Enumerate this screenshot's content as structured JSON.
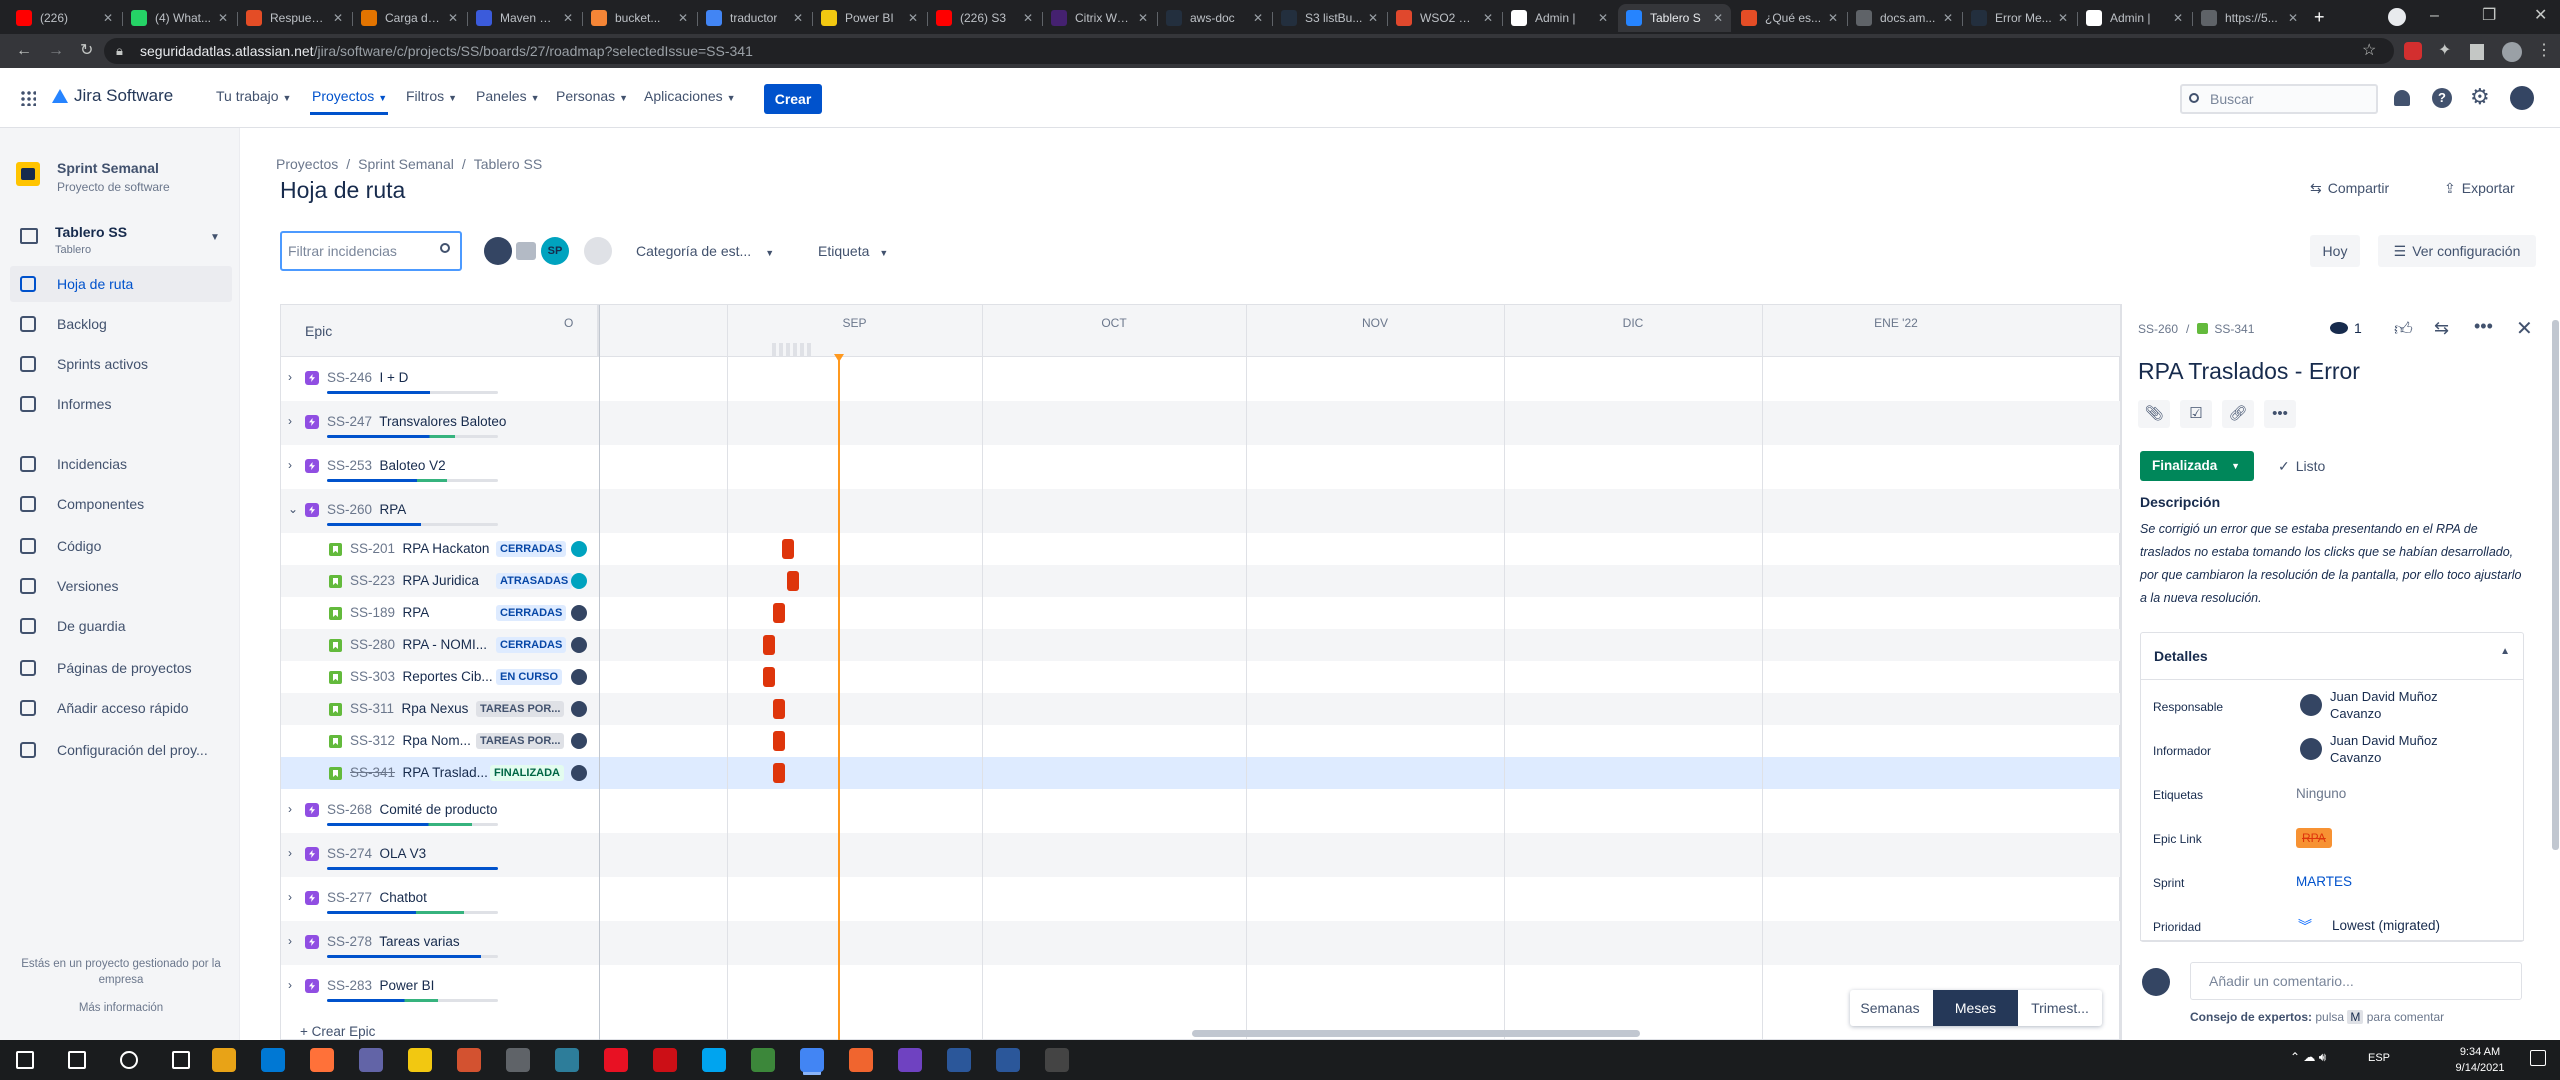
{
  "browser": {
    "tabs": [
      {
        "title": "(226)",
        "color": "#ff0000"
      },
      {
        "title": "(4) What...",
        "color": "#25d366"
      },
      {
        "title": "Respuest...",
        "color": "#e44d26"
      },
      {
        "title": "Carga de...",
        "color": "#e37400"
      },
      {
        "title": "Maven R...",
        "color": "#3b5bdb"
      },
      {
        "title": "bucket...",
        "color": "#f58536"
      },
      {
        "title": "traductor",
        "color": "#4285f4"
      },
      {
        "title": "Power BI",
        "color": "#f2c811"
      },
      {
        "title": "(226) S3",
        "color": "#ff0000"
      },
      {
        "title": "Citrix Wo...",
        "color": "#452170"
      },
      {
        "title": "aws-doc",
        "color": "#232f3e"
      },
      {
        "title": "S3 listBu...",
        "color": "#232f3e"
      },
      {
        "title": "WSO2 Er...",
        "color": "#e0482d"
      },
      {
        "title": "Admin |",
        "color": "#ffffff"
      },
      {
        "title": "Tablero S",
        "color": "#2684ff"
      },
      {
        "title": "¿Qué es...",
        "color": "#e44d26"
      },
      {
        "title": "docs.am...",
        "color": "#5f6368"
      },
      {
        "title": "Error Me...",
        "color": "#232f3e"
      },
      {
        "title": "Admin |",
        "color": "#ffffff"
      },
      {
        "title": "https://5...",
        "color": "#5f6368"
      }
    ],
    "url_host": "seguridadatlas.atlassian.net",
    "url_path": "/jira/software/c/projects/SS/boards/27/roadmap?selectedIssue=SS-341"
  },
  "topnav": {
    "logo": "Jira Software",
    "items": [
      "Tu trabajo",
      "Proyectos",
      "Filtros",
      "Paneles",
      "Personas",
      "Aplicaciones"
    ],
    "create": "Crear",
    "search_placeholder": "Buscar"
  },
  "sidebar": {
    "project_name": "Sprint Semanal",
    "project_type": "Proyecto de software",
    "board_name": "Tablero SS",
    "board_sub": "Tablero",
    "items": [
      "Hoja de ruta",
      "Backlog",
      "Sprints activos",
      "Informes",
      "Incidencias",
      "Componentes",
      "Código",
      "Versiones",
      "De guardia",
      "Páginas de proyectos",
      "Añadir acceso rápido",
      "Configuración del proy..."
    ],
    "footer": "Estás en un proyecto gestionado por la empresa",
    "more": "Más información"
  },
  "page": {
    "breadcrumbs": [
      "Proyectos",
      "Sprint Semanal",
      "Tablero SS"
    ],
    "title": "Hoja de ruta",
    "share": "Compartir",
    "export": "Exportar",
    "filter_placeholder": "Filtrar incidencias",
    "avatar_initials": "SP",
    "category_filter": "Categoría de est...",
    "label_filter": "Etiqueta",
    "today": "Hoy",
    "view_settings": "Ver configuración"
  },
  "roadmap": {
    "epic_header": "Epic",
    "months": [
      "O",
      "SEP",
      "OCT",
      "NOV",
      "DIC",
      "ENE '22"
    ],
    "epics_before": [
      {
        "key": "SS-246",
        "name": "I + D",
        "progress": 0.6,
        "green": 0.0
      },
      {
        "key": "SS-247",
        "name": "Transvalores Baloteo",
        "progress": 0.75,
        "green": 0.2
      },
      {
        "key": "SS-253",
        "name": "Baloteo V2",
        "progress": 0.7,
        "green": 0.25
      }
    ],
    "open_epic": {
      "key": "SS-260",
      "name": "RPA",
      "progress": 0.55,
      "green": 0.0
    },
    "children": [
      {
        "key": "SS-201",
        "name": "RPA Hackaton",
        "status": "CERRADAS",
        "style": "blue",
        "avatar": "teal",
        "strike": false,
        "month_offset": 0.86
      },
      {
        "key": "SS-223",
        "name": "RPA Juridica",
        "status": "ATRASADAS",
        "style": "blue",
        "avatar": "teal",
        "strike": false,
        "month_offset": 0.94
      },
      {
        "key": "SS-189",
        "name": "RPA",
        "status": "CERRADAS",
        "style": "blue",
        "avatar": "dark",
        "strike": false,
        "month_offset": 0.72
      },
      {
        "key": "SS-280",
        "name": "RPA - NOMI...",
        "status": "CERRADAS",
        "style": "blue",
        "avatar": "dark",
        "strike": false,
        "month_offset": 0.56
      },
      {
        "key": "SS-303",
        "name": "Reportes Cib...",
        "status": "EN CURSO",
        "style": "blue",
        "avatar": "dark",
        "strike": false,
        "month_offset": 0.56
      },
      {
        "key": "SS-311",
        "name": "Rpa Nexus",
        "status": "TAREAS POR...",
        "style": "gray",
        "avatar": "dark",
        "strike": false,
        "month_offset": 0.72
      },
      {
        "key": "SS-312",
        "name": "Rpa Nom...",
        "status": "TAREAS POR...",
        "style": "gray",
        "avatar": "dark",
        "strike": false,
        "month_offset": 0.72
      },
      {
        "key": "SS-341",
        "name": "RPA Traslad...",
        "status": "FINALIZADA",
        "style": "green",
        "avatar": "dark",
        "strike": true,
        "month_offset": 0.72
      }
    ],
    "epics_after": [
      {
        "key": "SS-268",
        "name": "Comité de producto",
        "progress": 0.85,
        "green": 0.3
      },
      {
        "key": "SS-274",
        "name": "OLA V3",
        "progress": 1.0,
        "green": 0.0
      },
      {
        "key": "SS-277",
        "name": "Chatbot",
        "progress": 0.8,
        "green": 0.35
      },
      {
        "key": "SS-278",
        "name": "Tareas varias",
        "progress": 0.9,
        "green": 0.0
      },
      {
        "key": "SS-283",
        "name": "Power BI",
        "progress": 0.65,
        "green": 0.3
      }
    ],
    "create_epic": "+ Crear Epic",
    "zoom": [
      "Semanas",
      "Meses",
      "Trimest..."
    ],
    "zoom_selected": "Meses"
  },
  "detail": {
    "parent_key": "SS-260",
    "issue_key": "SS-341",
    "watchers": "1",
    "title": "RPA Traslados - Error",
    "status": "Finalizada",
    "resolution": "Listo",
    "description_label": "Descripción",
    "description": "Se corrigió un error que se estaba presentando en el RPA de traslados no estaba tomando los clicks que se habían desarrollado, por que cambiaron la resolución de la pantalla, por ello toco ajustarlo a la nueva resolución.",
    "details_label": "Detalles",
    "fields": {
      "assignee_label": "Responsable",
      "assignee": "Juan David Muñoz Cavanzo",
      "reporter_label": "Informador",
      "reporter": "Juan David Muñoz Cavanzo",
      "labels_label": "Etiquetas",
      "labels": "Ninguno",
      "epic_label": "Epic Link",
      "epic": "RPA",
      "sprint_label": "Sprint",
      "sprint": "MARTES",
      "priority_label": "Prioridad",
      "priority": "Lowest (migrated)"
    },
    "comment_placeholder": "Añadir un comentario...",
    "tip_prefix": "Consejo de expertos:",
    "tip_mid": "pulsa",
    "tip_key": "M",
    "tip_suffix": "para comentar"
  },
  "taskbar": {
    "time": "9:34 AM",
    "date": "9/14/2021",
    "lang": "ESP"
  }
}
